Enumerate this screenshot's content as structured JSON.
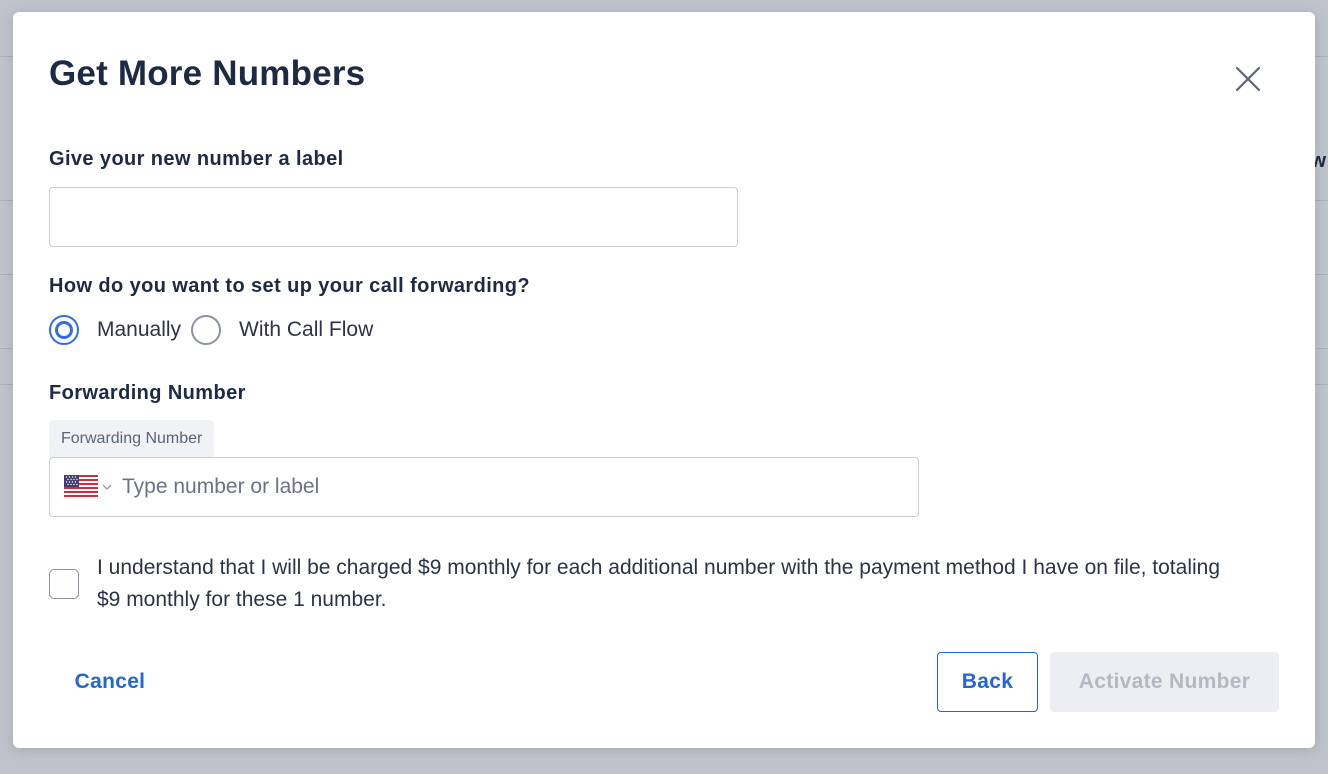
{
  "modal": {
    "title": "Get More Numbers",
    "label_field": {
      "label": "Give your new number a label",
      "value": "",
      "placeholder": ""
    },
    "forwarding_question": "How do you want to set up your call forwarding?",
    "forwarding_options": [
      {
        "label": "Manually",
        "selected": true
      },
      {
        "label": "With Call Flow",
        "selected": false
      }
    ],
    "forwarding_number": {
      "section_label": "Forwarding Number",
      "tag": "Forwarding Number",
      "country_flag": "us-flag-icon",
      "placeholder": "Type number or label"
    },
    "consent": {
      "checked": false,
      "text": "I understand that I will be charged $9 monthly for each additional number with the payment method I have on file, totaling $9 monthly for these 1 number."
    },
    "buttons": {
      "cancel": "Cancel",
      "back": "Back",
      "activate": "Activate Number"
    }
  },
  "background": {
    "partial_text": "w"
  },
  "colors": {
    "accent": "#2566d6",
    "radio_selected": "#2f6fde",
    "disabled_bg": "#edeef1",
    "disabled_text": "#b3b8c2",
    "heading": "#1d2a44",
    "overlay": "#bfc3cc"
  }
}
